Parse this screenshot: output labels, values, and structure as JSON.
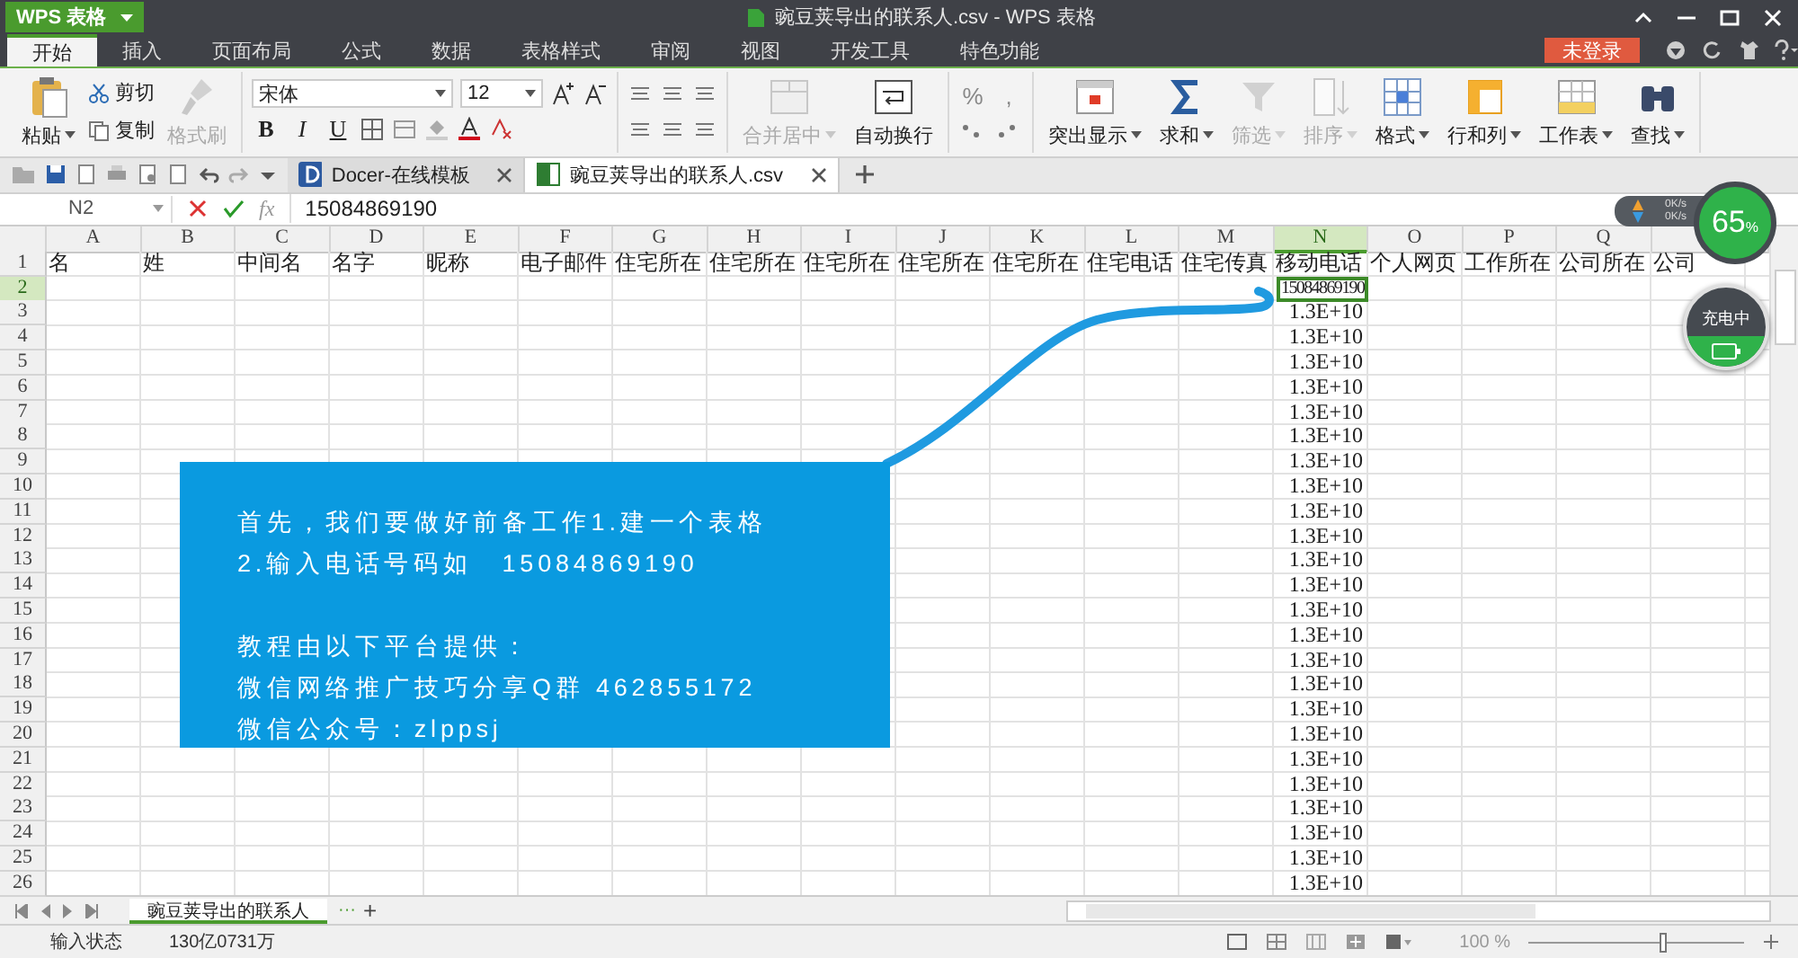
{
  "app_menu": "WPS 表格",
  "window": {
    "title": "豌豆荚导出的联系人.csv - WPS 表格"
  },
  "ribbon_tabs": [
    {
      "label": "开始",
      "selected": true
    },
    {
      "label": "插入",
      "selected": false
    },
    {
      "label": "页面布局",
      "selected": false
    },
    {
      "label": "公式",
      "selected": false
    },
    {
      "label": "数据",
      "selected": false
    },
    {
      "label": "表格样式",
      "selected": false
    },
    {
      "label": "审阅",
      "selected": false
    },
    {
      "label": "视图",
      "selected": false
    },
    {
      "label": "开发工具",
      "selected": false
    },
    {
      "label": "特色功能",
      "selected": false
    }
  ],
  "login_button": "未登录",
  "ribbon": {
    "paste": "粘贴",
    "cut": "剪切",
    "copy": "复制",
    "format_painter": {
      "label": "格式刷",
      "disabled": true
    },
    "font_name": "宋体",
    "font_size": "12",
    "bold": "B",
    "italic": "I",
    "underline": "U",
    "merge": {
      "label": "合并居中",
      "disabled": true
    },
    "wrap": {
      "label": "自动换行",
      "disabled": false
    },
    "percent": "%",
    "comma": ",",
    "tools": [
      {
        "kind": "highlight",
        "label": "突出显示",
        "disabled": false
      },
      {
        "kind": "sum",
        "label": "求和",
        "disabled": false
      },
      {
        "kind": "filter",
        "label": "筛选",
        "disabled": true
      },
      {
        "kind": "sort",
        "label": "排序",
        "disabled": true
      },
      {
        "kind": "format",
        "label": "格式",
        "disabled": false
      },
      {
        "kind": "rows",
        "label": "行和列",
        "disabled": false
      },
      {
        "kind": "sheet",
        "label": "工作表",
        "disabled": false
      },
      {
        "kind": "find",
        "label": "查找",
        "disabled": false
      }
    ]
  },
  "doc_tabs": [
    {
      "kind": "docer",
      "label": "Docer-在线模板",
      "selected": false
    },
    {
      "kind": "sheet",
      "label": "豌豆荚导出的联系人.csv",
      "selected": true
    }
  ],
  "formula_bar": {
    "name_box": "N2",
    "fx": "fx",
    "value": "15084869190"
  },
  "sheet": {
    "columns": [
      {
        "letter": "A",
        "selected": false
      },
      {
        "letter": "B",
        "selected": false
      },
      {
        "letter": "C",
        "selected": false
      },
      {
        "letter": "D",
        "selected": false
      },
      {
        "letter": "E",
        "selected": false
      },
      {
        "letter": "F",
        "selected": false
      },
      {
        "letter": "G",
        "selected": false
      },
      {
        "letter": "H",
        "selected": false
      },
      {
        "letter": "I",
        "selected": false
      },
      {
        "letter": "J",
        "selected": false
      },
      {
        "letter": "K",
        "selected": false
      },
      {
        "letter": "L",
        "selected": false
      },
      {
        "letter": "M",
        "selected": false
      },
      {
        "letter": "N",
        "selected": true
      },
      {
        "letter": "O",
        "selected": false
      },
      {
        "letter": "P",
        "selected": false
      },
      {
        "letter": "Q",
        "selected": false
      }
    ],
    "rows": [
      {
        "number": "1",
        "selected": false,
        "kind": "text",
        "cells": {
          "A": "名",
          "B": "姓",
          "C": "中间名",
          "D": "名字",
          "E": "昵称",
          "F": "电子邮件",
          "G": "住宅所在",
          "H": "住宅所在",
          "I": "住宅所在",
          "J": "住宅所在",
          "K": "住宅所在",
          "L": "住宅电话",
          "M": "住宅传真",
          "N": "移动电话",
          "O": "个人网页",
          "P": "工作所在",
          "Q": "公司所在",
          "R": "公司"
        }
      },
      {
        "number": "2",
        "selected": true,
        "kind": "text",
        "cells": {
          "N": "15084869190"
        }
      },
      {
        "number": "3",
        "selected": false,
        "kind": "number",
        "cells": {
          "N": "1.3E+10"
        }
      },
      {
        "number": "4",
        "selected": false,
        "kind": "number",
        "cells": {
          "N": "1.3E+10"
        }
      },
      {
        "number": "5",
        "selected": false,
        "kind": "number",
        "cells": {
          "N": "1.3E+10"
        }
      },
      {
        "number": "6",
        "selected": false,
        "kind": "number",
        "cells": {
          "N": "1.3E+10"
        }
      },
      {
        "number": "7",
        "selected": false,
        "kind": "number",
        "cells": {
          "N": "1.3E+10"
        }
      },
      {
        "number": "8",
        "selected": false,
        "kind": "number",
        "cells": {
          "N": "1.3E+10"
        }
      },
      {
        "number": "9",
        "selected": false,
        "kind": "number",
        "cells": {
          "N": "1.3E+10"
        }
      },
      {
        "number": "10",
        "selected": false,
        "kind": "number",
        "cells": {
          "N": "1.3E+10"
        }
      },
      {
        "number": "11",
        "selected": false,
        "kind": "number",
        "cells": {
          "N": "1.3E+10"
        }
      },
      {
        "number": "12",
        "selected": false,
        "kind": "number",
        "cells": {
          "N": "1.3E+10"
        }
      },
      {
        "number": "13",
        "selected": false,
        "kind": "number",
        "cells": {
          "N": "1.3E+10"
        }
      },
      {
        "number": "14",
        "selected": false,
        "kind": "number",
        "cells": {
          "N": "1.3E+10"
        }
      },
      {
        "number": "15",
        "selected": false,
        "kind": "number",
        "cells": {
          "N": "1.3E+10"
        }
      },
      {
        "number": "16",
        "selected": false,
        "kind": "number",
        "cells": {
          "N": "1.3E+10"
        }
      },
      {
        "number": "17",
        "selected": false,
        "kind": "number",
        "cells": {
          "N": "1.3E+10"
        }
      },
      {
        "number": "18",
        "selected": false,
        "kind": "number",
        "cells": {
          "N": "1.3E+10"
        }
      },
      {
        "number": "19",
        "selected": false,
        "kind": "number",
        "cells": {
          "N": "1.3E+10"
        }
      },
      {
        "number": "20",
        "selected": false,
        "kind": "number",
        "cells": {
          "N": "1.3E+10"
        }
      },
      {
        "number": "21",
        "selected": false,
        "kind": "number",
        "cells": {
          "N": "1.3E+10"
        }
      },
      {
        "number": "22",
        "selected": false,
        "kind": "number",
        "cells": {
          "N": "1.3E+10"
        }
      },
      {
        "number": "23",
        "selected": false,
        "kind": "number",
        "cells": {
          "N": "1.3E+10"
        }
      },
      {
        "number": "24",
        "selected": false,
        "kind": "number",
        "cells": {
          "N": "1.3E+10"
        }
      },
      {
        "number": "25",
        "selected": false,
        "kind": "number",
        "cells": {
          "N": "1.3E+10"
        }
      },
      {
        "number": "26",
        "selected": false,
        "kind": "number",
        "cells": {
          "N": "1.3E+10"
        }
      }
    ]
  },
  "callout": {
    "lines": [
      "首先，我们要做好前备工作1.建一个表格",
      "2.输入电话号码如　15084869190"
    ],
    "lines_2": [
      "教程由以下平台提供：",
      "微信网络推广技巧分享Q群 462855172",
      "微信公众号：zlppsj"
    ]
  },
  "widget": {
    "upload": "0K/s",
    "download": "0K/s",
    "battery": "65",
    "percent": "%",
    "charging": "充电中"
  },
  "sheet_tabs": [
    {
      "label": "豌豆荚导出的联系人",
      "selected": true
    }
  ],
  "more_sheets": "···",
  "add_sheet": "+",
  "status_bar": {
    "mode": "输入状态",
    "sum": "130亿0731万",
    "zoom": "100 %",
    "level": 0.63
  }
}
